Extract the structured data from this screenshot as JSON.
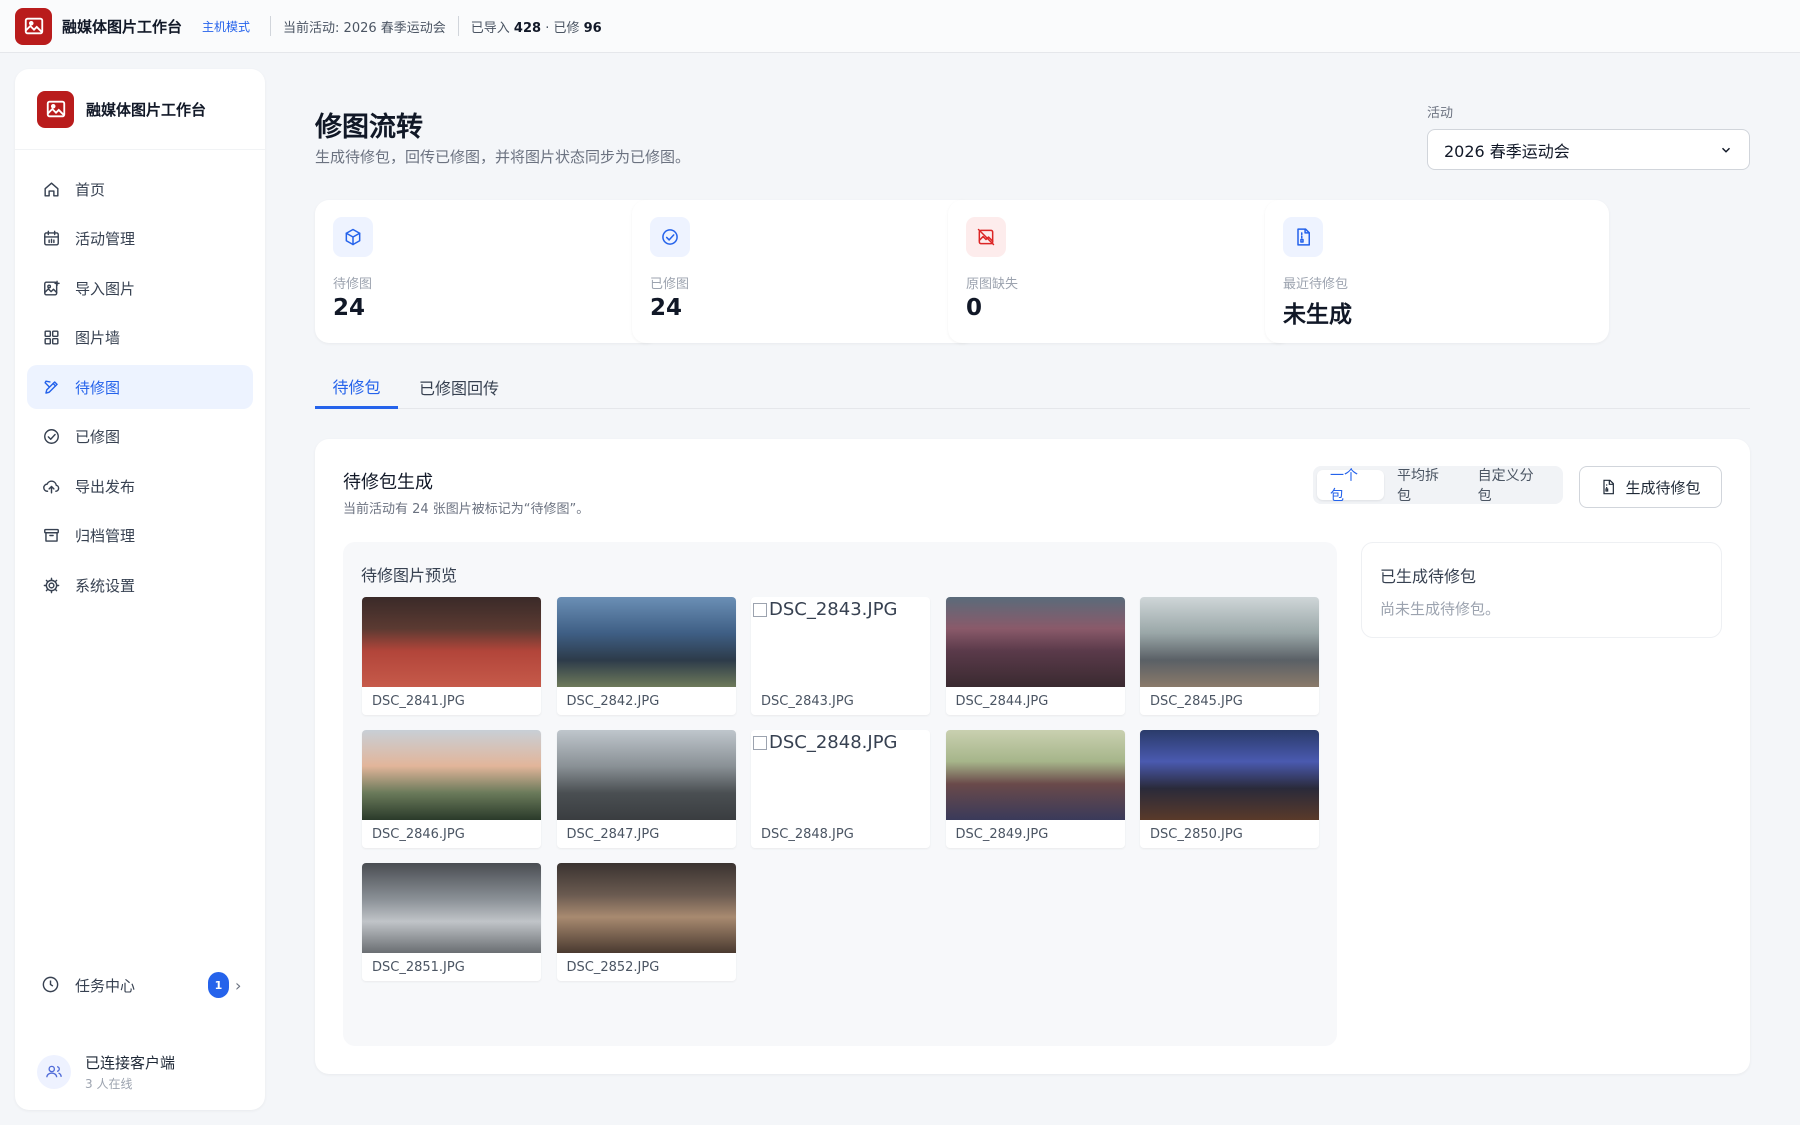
{
  "topbar": {
    "title": "融媒体图片工作台",
    "mode": "主机模式",
    "activity_label": "当前活动: 2026 春季运动会",
    "imported_label": "已导入",
    "imported_count": "428",
    "dot": "·",
    "retouched_label": "已修",
    "retouched_count": "96"
  },
  "sidebar": {
    "brand": "融媒体图片工作台",
    "items": [
      {
        "label": "首页",
        "icon": "home-icon"
      },
      {
        "label": "活动管理",
        "icon": "calendar-icon"
      },
      {
        "label": "导入图片",
        "icon": "image-plus-icon"
      },
      {
        "label": "图片墙",
        "icon": "grid-icon"
      },
      {
        "label": "待修图",
        "icon": "brush-icon"
      },
      {
        "label": "已修图",
        "icon": "check-circle-icon"
      },
      {
        "label": "导出发布",
        "icon": "upload-cloud-icon"
      },
      {
        "label": "归档管理",
        "icon": "archive-icon"
      },
      {
        "label": "系统设置",
        "icon": "gear-icon"
      }
    ],
    "active_index": 4,
    "task_center": {
      "label": "任务中心",
      "badge": "1"
    },
    "client": {
      "title": "已连接客户端",
      "subtitle": "3 人在线"
    }
  },
  "main": {
    "title": "修图流转",
    "subtitle": "生成待修包，回传已修图，并将图片状态同步为已修图。",
    "activity_select": {
      "label": "活动",
      "value": "2026 春季运动会"
    },
    "stats": [
      {
        "label": "待修图",
        "value": "24",
        "icon": "package-icon",
        "color": "#2563eb",
        "bg": "#eef3ff"
      },
      {
        "label": "已修图",
        "value": "24",
        "icon": "check-circle-icon",
        "color": "#2563eb",
        "bg": "#eef3ff"
      },
      {
        "label": "原图缺失",
        "value": "0",
        "icon": "image-off-icon",
        "color": "#dc2626",
        "bg": "#fdecec"
      },
      {
        "label": "最近待修包",
        "value": "未生成",
        "icon": "file-archive-icon",
        "color": "#2563eb",
        "bg": "#eef3ff"
      }
    ],
    "tabs": [
      "待修包",
      "已修图回传"
    ],
    "active_tab": 0,
    "panel": {
      "title": "待修包生成",
      "subtitle": "当前活动有 24 张图片被标记为“待修图”。",
      "modes": [
        "一个包",
        "平均拆包",
        "自定义分包"
      ],
      "active_mode": 0,
      "generate_label": "生成待修包",
      "preview_title": "待修图片预览",
      "images": [
        {
          "name": "DSC_2841.JPG",
          "broken": false
        },
        {
          "name": "DSC_2842.JPG",
          "broken": false
        },
        {
          "name": "DSC_2843.JPG",
          "broken": true
        },
        {
          "name": "DSC_2844.JPG",
          "broken": false
        },
        {
          "name": "DSC_2845.JPG",
          "broken": false
        },
        {
          "name": "DSC_2846.JPG",
          "broken": false
        },
        {
          "name": "DSC_2847.JPG",
          "broken": false
        },
        {
          "name": "DSC_2848.JPG",
          "broken": true
        },
        {
          "name": "DSC_2849.JPG",
          "broken": false
        },
        {
          "name": "DSC_2850.JPG",
          "broken": false
        },
        {
          "name": "DSC_2851.JPG",
          "broken": false
        },
        {
          "name": "DSC_2852.JPG",
          "broken": false
        }
      ],
      "generated_title": "已生成待修包",
      "generated_empty": "尚未生成待修包。"
    }
  }
}
